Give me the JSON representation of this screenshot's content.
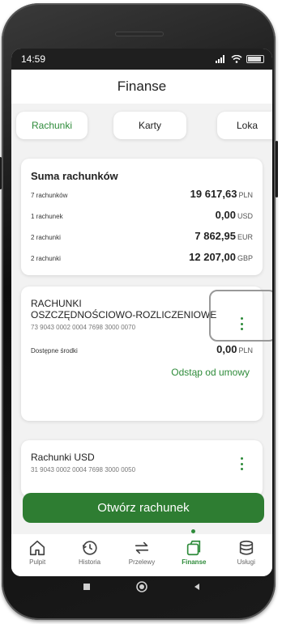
{
  "status": {
    "time": "14:59",
    "signal_label": "R"
  },
  "header": {
    "title": "Finanse"
  },
  "tabs": [
    {
      "label": "Rachunki"
    },
    {
      "label": "Karty"
    },
    {
      "label": "Loka"
    }
  ],
  "summary": {
    "title": "Suma rachunków",
    "rows": [
      {
        "label": "7 rachunków",
        "amount": "19 617,63",
        "currency": "PLN"
      },
      {
        "label": "1 rachunek",
        "amount": "0,00",
        "currency": "USD"
      },
      {
        "label": "2 rachunki",
        "amount": "7 862,95",
        "currency": "EUR"
      },
      {
        "label": "2 rachunki",
        "amount": "12 207,00",
        "currency": "GBP"
      }
    ]
  },
  "account1": {
    "title_line1": "RACHUNKI",
    "title_line2": "OSZCZĘDNOŚCIOWO-ROZLICZENIOWE",
    "number": "73 9043 0002 0004 7698 3000 0070",
    "balance_label": "Dostępne środki",
    "balance": "0,00",
    "currency": "PLN",
    "withdraw_link": "Odstąp od umowy"
  },
  "account2": {
    "title": "Rachunki USD",
    "number": "31 9043 0002 0004 7698 3000 0050"
  },
  "cta": {
    "label": "Otwórz rachunek"
  },
  "bottom_nav": [
    {
      "label": "Pulpit",
      "icon": "home-icon"
    },
    {
      "label": "Historia",
      "icon": "history-icon"
    },
    {
      "label": "Przelewy",
      "icon": "transfer-icon"
    },
    {
      "label": "Finanse",
      "icon": "finance-icon",
      "active": true
    },
    {
      "label": "Usługi",
      "icon": "services-icon"
    }
  ],
  "colors": {
    "accent": "#2e8b3a",
    "cta": "#2e7d32",
    "background": "#f2f2f2"
  }
}
